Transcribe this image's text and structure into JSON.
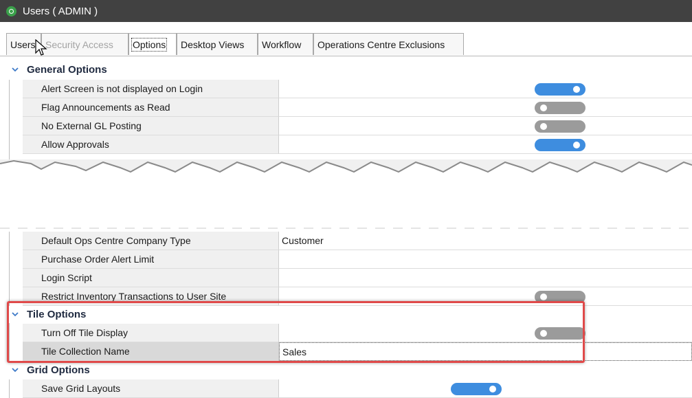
{
  "window": {
    "title": "Users ( ADMIN )"
  },
  "tabs": [
    {
      "label": "Users",
      "state": "normal"
    },
    {
      "label": "Security Access",
      "state": "disabled"
    },
    {
      "label": "Options",
      "state": "active"
    },
    {
      "label": "Desktop Views",
      "state": "normal"
    },
    {
      "label": "Workflow",
      "state": "normal"
    },
    {
      "label": "Operations Centre Exclusions",
      "state": "normal"
    }
  ],
  "sections": {
    "general": {
      "title": "General Options",
      "rows_top": [
        {
          "label": "Alert Screen is not displayed on Login",
          "toggle": "on"
        },
        {
          "label": "Flag Announcements as Read",
          "toggle": "off"
        },
        {
          "label": "No External GL Posting",
          "toggle": "off"
        },
        {
          "label": "Allow Approvals",
          "toggle": "on"
        }
      ],
      "rows_bottom": [
        {
          "label": "Default Ops Centre Company Type",
          "value": "Customer"
        },
        {
          "label": "Purchase Order Alert Limit",
          "value": ""
        },
        {
          "label": "Login Script",
          "value": ""
        },
        {
          "label": "Restrict Inventory Transactions to User Site",
          "toggle": "off"
        }
      ]
    },
    "tile": {
      "title": "Tile Options",
      "rows": [
        {
          "label": "Turn Off Tile Display",
          "toggle": "off"
        },
        {
          "label": "Tile Collection Name",
          "value": "Sales"
        }
      ]
    },
    "grid": {
      "title": "Grid Options",
      "rows": [
        {
          "label": "Save Grid Layouts",
          "toggle": "on"
        }
      ]
    }
  },
  "colors": {
    "title_bar": "#414141",
    "toggle_on": "#3e8ddf",
    "toggle_off": "#9b9b9b",
    "highlight_border": "#e04a4a"
  },
  "icons": [
    "app-logo-icon",
    "chevron-down-icon",
    "mouse-cursor-icon"
  ]
}
